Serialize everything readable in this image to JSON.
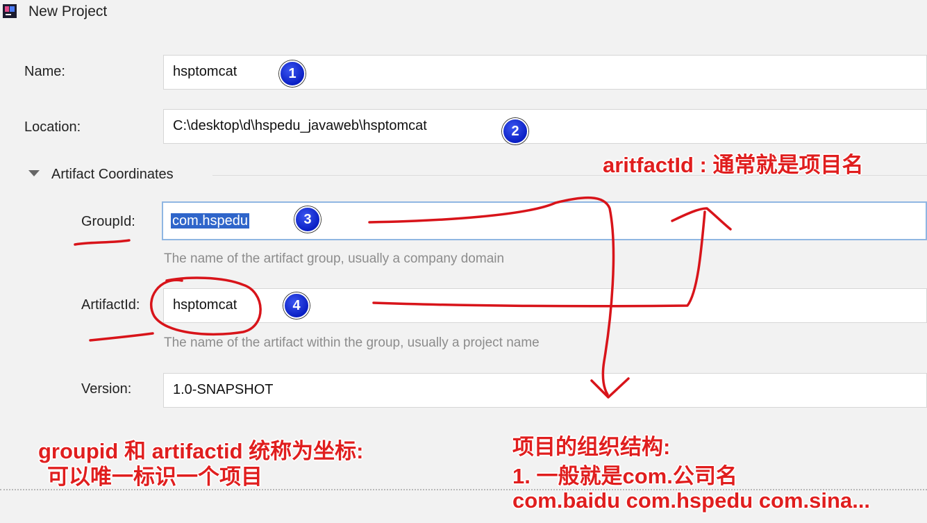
{
  "window": {
    "title": "New Project",
    "app_icon": "intellij-icon"
  },
  "form": {
    "name": {
      "label": "Name:",
      "value": "hsptomcat"
    },
    "location": {
      "label": "Location:",
      "value": "C:\\desktop\\d\\hspedu_javaweb\\hsptomcat"
    },
    "artifact_section": {
      "label": "Artifact Coordinates",
      "icon": "triangle-down-icon"
    },
    "group_id": {
      "label": "GroupId:",
      "value": "com.hspedu",
      "hint": "The name of the artifact group, usually a company domain"
    },
    "artifact_id": {
      "label": "ArtifactId:",
      "value": "hsptomcat",
      "hint": "The name of the artifact within the group, usually a project name"
    },
    "version": {
      "label": "Version:",
      "value": "1.0-SNAPSHOT"
    }
  },
  "badges": [
    "1",
    "2",
    "3",
    "4"
  ],
  "annotations": {
    "artifact_note": "aritfactId : 通常就是项目名",
    "coord_line1": "groupid 和 artifactid 统称为坐标:",
    "coord_line2": "可以唯一标识一个项目",
    "structure_line1": "项目的组织结构:",
    "structure_line2": "1. 一般就是com.公司名",
    "structure_line3": "com.baidu com.hspedu com.sina..."
  },
  "colors": {
    "annotation": "#e01e1e",
    "badge": "#0a1fc4",
    "selection": "#2f65ca",
    "focus_border": "#8fb6e2"
  }
}
